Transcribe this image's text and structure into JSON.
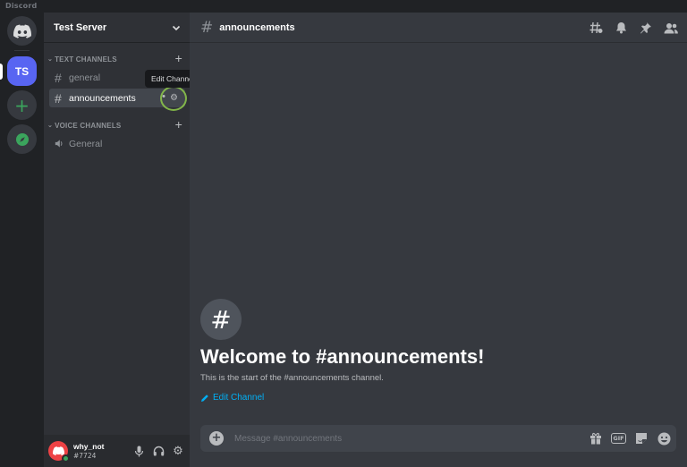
{
  "window": {
    "title": "Discord"
  },
  "servers": {
    "home_icon": "discord-logo-icon",
    "items": [
      {
        "abbr": "TS",
        "name": "Test Server"
      }
    ],
    "add_icon": "plus-icon",
    "explore_icon": "compass-icon"
  },
  "sidebar": {
    "server_name": "Test Server",
    "categories": [
      {
        "label": "TEXT CHANNELS",
        "channels": [
          "general",
          "announcements"
        ]
      },
      {
        "label": "VOICE CHANNELS",
        "channels": [
          "General"
        ]
      }
    ],
    "active_channel": "announcements",
    "tooltip": "Edit Channel"
  },
  "user": {
    "name": "why_not",
    "tag": "#7724",
    "status": "online"
  },
  "channel": {
    "name": "announcements",
    "header_icons": [
      "threads-icon",
      "bell-icon",
      "pin-icon",
      "members-icon"
    ]
  },
  "welcome": {
    "title": "Welcome to #announcements!",
    "subtitle": "This is the start of the #announcements channel.",
    "edit_link": "Edit Channel"
  },
  "composer": {
    "placeholder": "Message #announcements",
    "gif_label": "GIF",
    "icons": [
      "gift-icon",
      "gif-icon",
      "sticker-icon",
      "emoji-icon"
    ]
  },
  "colors": {
    "accent": "#5865f2",
    "link": "#00aff4",
    "online": "#3ba55d",
    "highlight": "#8bc34a"
  }
}
